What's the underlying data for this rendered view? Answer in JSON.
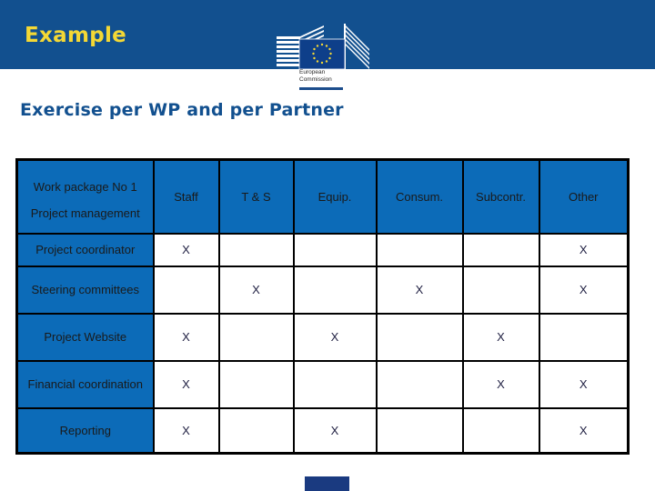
{
  "header": {
    "slide_label": "Example",
    "logo": {
      "icon": "european-commission-logo",
      "text_line1": "European",
      "text_line2": "Commission"
    },
    "colors": {
      "bar": "#12508f",
      "label": "#f4d835"
    }
  },
  "title": "Exercise per WP and per Partner",
  "table": {
    "corner_line1": "Work package No 1",
    "corner_line2": "Project management",
    "columns": [
      "Staff",
      "T & S",
      "Equip.",
      "Consum.",
      "Subcontr.",
      "Other"
    ],
    "mark_symbol": "X",
    "rows": [
      {
        "label": "Project coordinator",
        "cells": [
          "X",
          "",
          "",
          "",
          "",
          "X"
        ]
      },
      {
        "label": "Steering committees",
        "cells": [
          "",
          "X",
          "",
          "X",
          "",
          "X"
        ]
      },
      {
        "label": "Project Website",
        "cells": [
          "X",
          "",
          "X",
          "",
          "X",
          ""
        ]
      },
      {
        "label": "Financial coordination",
        "cells": [
          "X",
          "",
          "",
          "",
          "X",
          "X"
        ]
      },
      {
        "label": "Reporting",
        "cells": [
          "X",
          "",
          "X",
          "",
          "",
          "X"
        ]
      }
    ],
    "colors": {
      "header_fill": "#0c6bb8",
      "header_text": "#ffffff",
      "border": "#000000"
    }
  }
}
